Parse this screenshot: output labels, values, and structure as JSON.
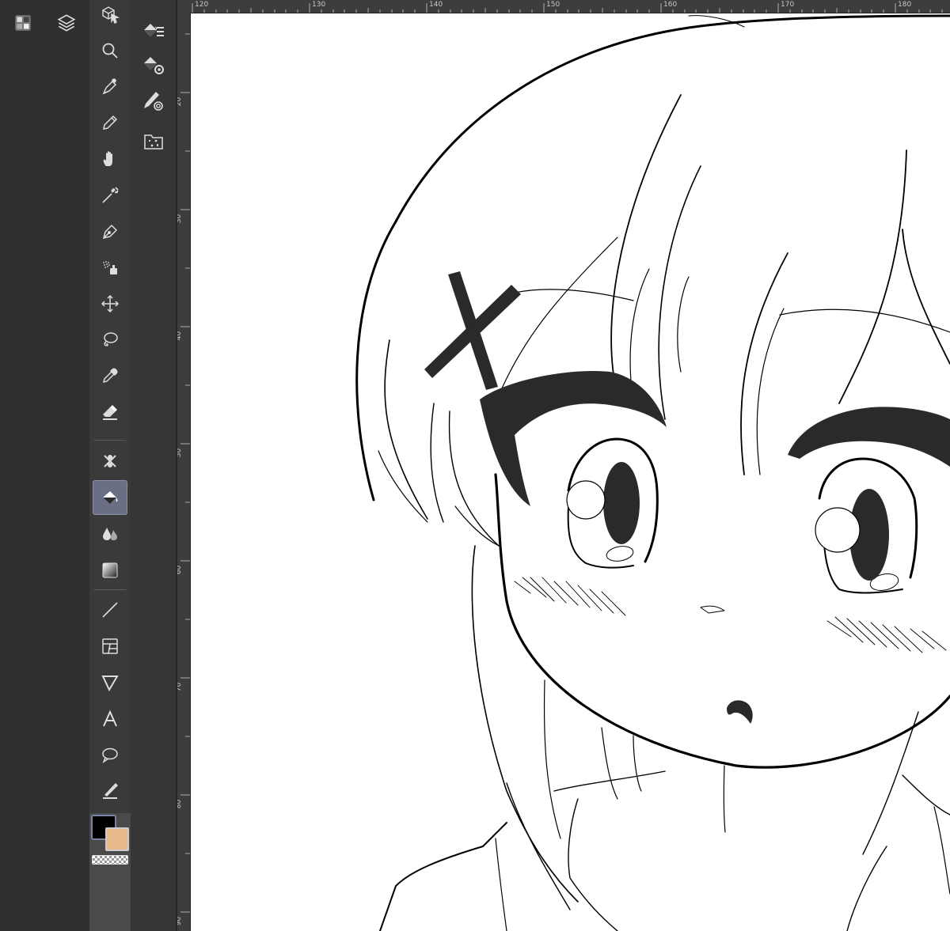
{
  "rulers": {
    "horizontal": [
      "120",
      "130",
      "140",
      "150",
      "160",
      "170",
      "180"
    ],
    "vertical": [
      "20",
      "30",
      "40",
      "50",
      "60",
      "70",
      "80",
      "90"
    ]
  },
  "left_panel": {
    "buttons": [
      "grid-panel-icon",
      "layers-icon"
    ]
  },
  "toolbar": {
    "tools": [
      "object-select-icon",
      "zoom-icon",
      "pen-icon",
      "pencil-icon",
      "hand-icon",
      "magic-wand-icon",
      "ink-pen-icon",
      "airbrush-icon",
      "move-icon",
      "lasso-icon",
      "eyedropper-icon",
      "eraser-icon",
      "blend-icon",
      "fill-icon",
      "watercolor-icon",
      "gradient-icon",
      "line-icon",
      "frame-border-icon",
      "ruler-icon",
      "text-icon",
      "balloon-icon",
      "correction-line-icon"
    ],
    "active_tool": "fill-icon"
  },
  "subtool": {
    "buttons": [
      "fill-referenced-icon",
      "fill-settings-icon",
      "paint-unfilled-icon",
      "material-folder-icon"
    ]
  },
  "colors": {
    "foreground": "#000000",
    "background": "#e6b98a",
    "accent": "#6a6f86"
  }
}
